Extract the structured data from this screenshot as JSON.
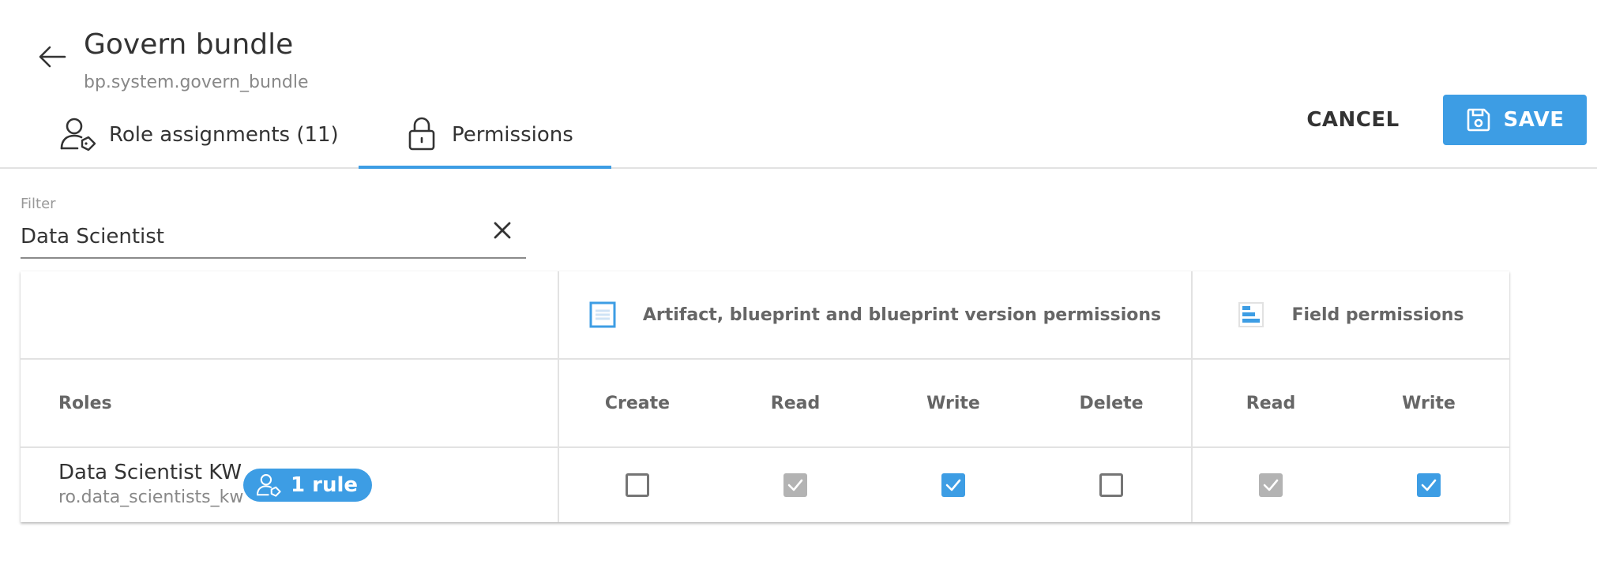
{
  "header": {
    "title": "Govern bundle",
    "subtitle": "bp.system.govern_bundle",
    "back_icon": "arrow-left-icon"
  },
  "tabs": [
    {
      "label": "Role assignments (11)",
      "icon": "user-tag-icon",
      "active": false
    },
    {
      "label": "Permissions",
      "icon": "lock-icon",
      "active": true
    }
  ],
  "actions": {
    "cancel_label": "CANCEL",
    "save_label": "SAVE",
    "save_icon": "floppy-disk-icon"
  },
  "filter": {
    "label": "Filter",
    "value": "Data Scientist",
    "clear_icon": "close-icon"
  },
  "table": {
    "groups": [
      {
        "label": "Artifact, blueprint and blueprint version permissions",
        "icon": "document-icon"
      },
      {
        "label": "Field permissions",
        "icon": "fields-icon"
      }
    ],
    "roles_header": "Roles",
    "columns": [
      "Create",
      "Read",
      "Write",
      "Delete",
      "Read",
      "Write"
    ],
    "rows": [
      {
        "name": "Data Scientist KW",
        "id": "ro.data_scientists_kw",
        "badge": "1 rule",
        "permissions": [
          "unchecked",
          "checked-disabled",
          "checked",
          "unchecked",
          "checked-disabled",
          "checked"
        ]
      }
    ]
  },
  "colors": {
    "accent": "#3d9de4",
    "checked_disabled": "#b3b3b3",
    "border": "#e2e2e2"
  }
}
